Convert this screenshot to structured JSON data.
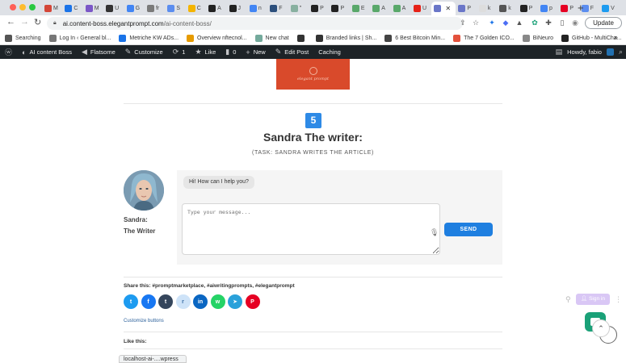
{
  "browser": {
    "tabs": [
      {
        "label": "M",
        "color": "#d44638"
      },
      {
        "label": "C",
        "color": "#1a73e8"
      },
      {
        "label": "M",
        "color": "#7b57c7"
      },
      {
        "label": "U",
        "color": "#333333"
      },
      {
        "label": "G",
        "color": "#4285f4"
      },
      {
        "label": "fr",
        "color": "#7a7a7a"
      },
      {
        "label": "S",
        "color": "#5b8def"
      },
      {
        "label": "C",
        "color": "#f4b400"
      },
      {
        "label": "A",
        "color": "#222222"
      },
      {
        "label": "J",
        "color": "#222222"
      },
      {
        "label": "n",
        "color": "#4285f4"
      },
      {
        "label": "F",
        "color": "#2c4f7c"
      },
      {
        "label": "\"",
        "color": "#88b0a0"
      },
      {
        "label": "P",
        "color": "#222222"
      },
      {
        "label": "P",
        "color": "#222222"
      },
      {
        "label": "E",
        "color": "#59a86a"
      },
      {
        "label": "A",
        "color": "#59a86a"
      },
      {
        "label": "A",
        "color": "#59a86a"
      },
      {
        "label": "U",
        "color": "#e62117"
      },
      {
        "label": "",
        "color": "#6a76c8",
        "active": true
      },
      {
        "label": "P",
        "color": "#6a76c8"
      },
      {
        "label": "k",
        "color": "#dddddd"
      },
      {
        "label": "k",
        "color": "#555555"
      },
      {
        "label": "P",
        "color": "#222222"
      },
      {
        "label": "p",
        "color": "#4285f4"
      },
      {
        "label": "P",
        "color": "#e60023"
      },
      {
        "label": "F",
        "color": "#5b8def"
      },
      {
        "label": "V",
        "color": "#1d9bf0"
      }
    ],
    "url_host": "ai.content-boss.elegantprompt.com",
    "url_path": "/ai-content-boss/",
    "update_label": "Update",
    "bookmarks": [
      {
        "label": "Searching",
        "color": "#555555"
      },
      {
        "label": "Log In ‹ General bl...",
        "color": "#777777"
      },
      {
        "label": "Metriche KW ADs...",
        "color": "#1a73e8"
      },
      {
        "label": "Overview nftecnol...",
        "color": "#e69b00"
      },
      {
        "label": "New chat",
        "color": "#74aa9c"
      },
      {
        "label": "",
        "color": "#333333"
      },
      {
        "label": "Branded links | Sh...",
        "color": "#333333"
      },
      {
        "label": "6 Best Bitcoin Min...",
        "color": "#444444"
      },
      {
        "label": "The 7 Golden ICO...",
        "color": "#e3513c"
      },
      {
        "label": "BiNeuro",
        "color": "#888888"
      },
      {
        "label": "GitHub - MultiCha...",
        "color": "#222222"
      }
    ]
  },
  "adminbar": {
    "site": "AI content Boss",
    "theme": "Flatsome",
    "customize": "Customize",
    "updates": "1",
    "like": "Like",
    "comments": "0",
    "new": "New",
    "edit": "Edit Post",
    "caching": "Caching",
    "howdy": "Howdy, fabio"
  },
  "page": {
    "banner_text": "elegant prompt",
    "step_number": "5",
    "title": "Sandra The writer:",
    "subtitle": "(TASK: SANDRA WRITES THE ARTICLE)",
    "agent_name_line1": "Sandra:",
    "agent_name_line2": "The Writer",
    "greeting": "Hi! How can I help you?",
    "input_placeholder": "Type your message...",
    "send_label": "SEND",
    "share_text": "Share this: #promptmarketplace, #aiwritingprompts, #elegantprompt",
    "share_buttons": [
      {
        "name": "twitter",
        "glyph": "t",
        "color": "#1d9bf0"
      },
      {
        "name": "facebook",
        "glyph": "f",
        "color": "#1877f2"
      },
      {
        "name": "tumblr",
        "glyph": "t",
        "color": "#35465c"
      },
      {
        "name": "reddit",
        "glyph": "r",
        "color": "#cee3f8"
      },
      {
        "name": "linkedin",
        "glyph": "in",
        "color": "#0a66c2"
      },
      {
        "name": "whatsapp",
        "glyph": "w",
        "color": "#25d366"
      },
      {
        "name": "telegram",
        "glyph": "➤",
        "color": "#2aa1da"
      },
      {
        "name": "pinterest",
        "glyph": "P",
        "color": "#e60023"
      }
    ],
    "customize_buttons": "Customize buttons",
    "like_this": "Like this:",
    "signin_label": "Sign in"
  },
  "status": {
    "link": "localhost-ai-....wpress"
  }
}
